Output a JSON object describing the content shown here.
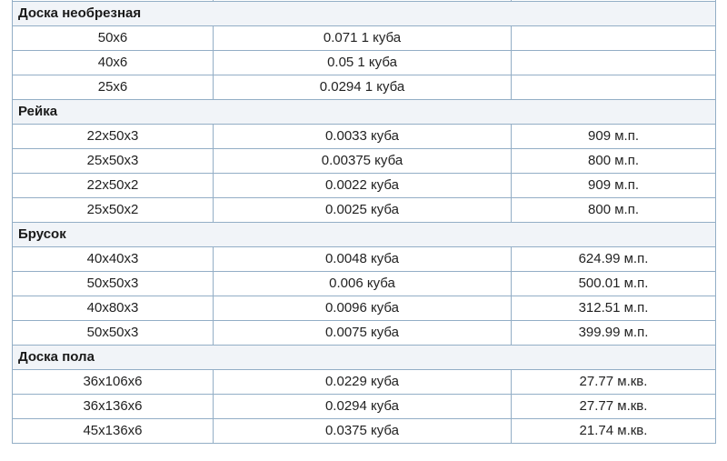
{
  "sections": [
    {
      "title": "Доска необрезная",
      "rows": [
        {
          "size": "50x6",
          "volume": "0.071 1 куба",
          "length": ""
        },
        {
          "size": "40x6",
          "volume": "0.05 1 куба",
          "length": ""
        },
        {
          "size": "25x6",
          "volume": "0.0294 1 куба",
          "length": ""
        }
      ]
    },
    {
      "title": "Рейка",
      "rows": [
        {
          "size": "22x50x3",
          "volume": "0.0033 куба",
          "length": "909 м.п."
        },
        {
          "size": "25x50x3",
          "volume": "0.00375 куба",
          "length": "800 м.п."
        },
        {
          "size": "22x50x2",
          "volume": "0.0022 куба",
          "length": "909 м.п."
        },
        {
          "size": "25x50x2",
          "volume": "0.0025 куба",
          "length": "800 м.п."
        }
      ]
    },
    {
      "title": "Брусок",
      "rows": [
        {
          "size": "40x40x3",
          "volume": "0.0048 куба",
          "length": "624.99 м.п."
        },
        {
          "size": "50x50x3",
          "volume": "0.006 куба",
          "length": "500.01 м.п."
        },
        {
          "size": "40x80x3",
          "volume": "0.0096 куба",
          "length": "312.51 м.п."
        },
        {
          "size": "50x50x3",
          "volume": "0.0075 куба",
          "length": "399.99 м.п."
        }
      ]
    },
    {
      "title": "Доска пола",
      "rows": [
        {
          "size": "36x106x6",
          "volume": "0.0229 куба",
          "length": "27.77 м.кв."
        },
        {
          "size": "36x136x6",
          "volume": "0.0294 куба",
          "length": "27.77 м.кв."
        },
        {
          "size": "45x136x6",
          "volume": "0.0375 куба",
          "length": "21.74 м.кв."
        }
      ]
    }
  ]
}
